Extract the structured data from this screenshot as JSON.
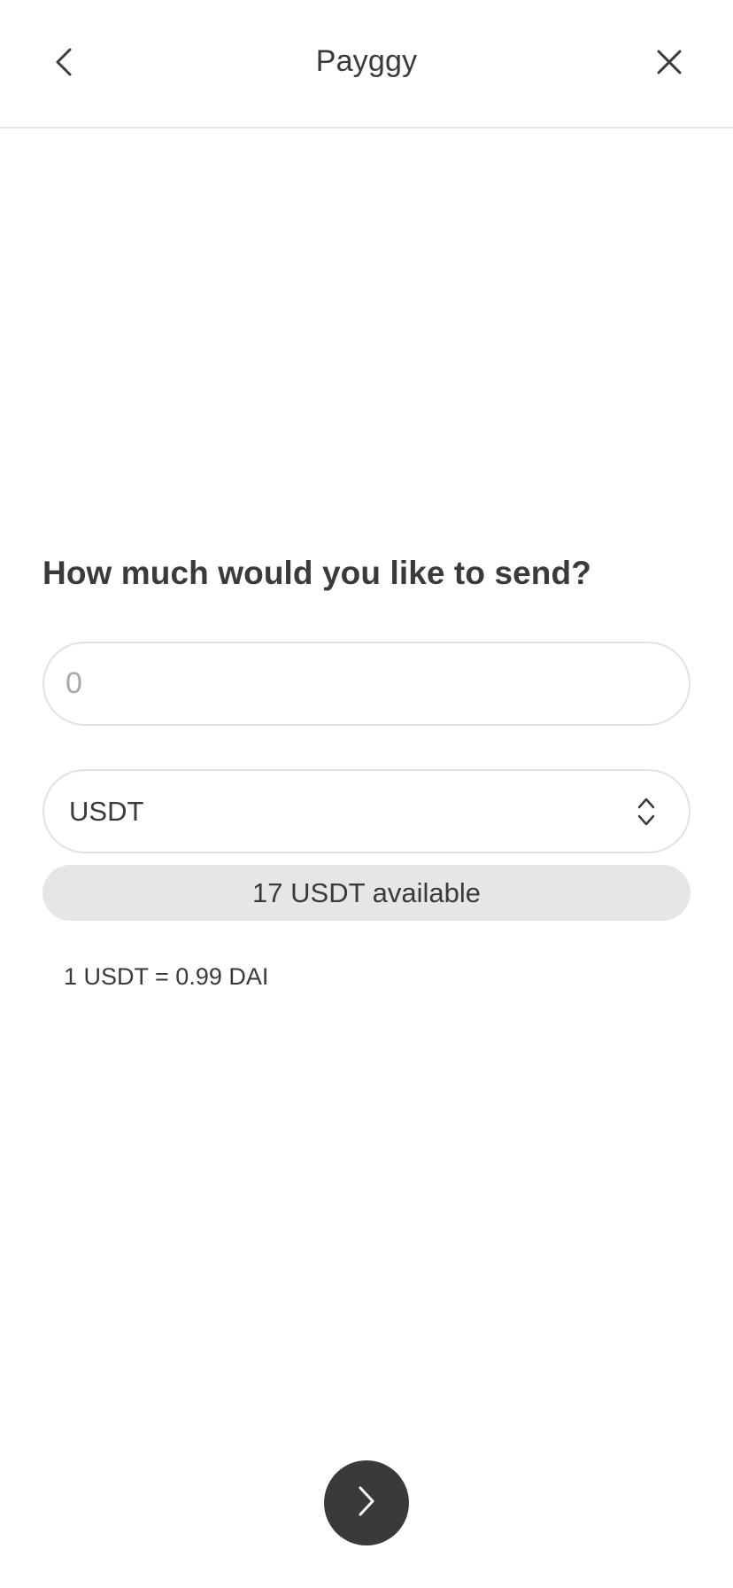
{
  "header": {
    "title": "Payggy",
    "back_icon": "chevron-left-icon",
    "close_icon": "close-icon"
  },
  "form": {
    "question": "How much would you like to send?",
    "amount": {
      "value": "",
      "placeholder": "0"
    },
    "token_select": {
      "selected": "USDT",
      "icon": "chevron-up-down-icon"
    },
    "available_text": "17 USDT available",
    "rate_text": "1 USDT = 0.99 DAI"
  },
  "footer": {
    "next_icon": "chevron-right-icon"
  },
  "colors": {
    "text": "#3a3a3a",
    "border": "#e2e2e2",
    "pill_bg": "#e6e6e6",
    "button_bg": "#3a3a3a",
    "placeholder": "#a8a8a8"
  }
}
